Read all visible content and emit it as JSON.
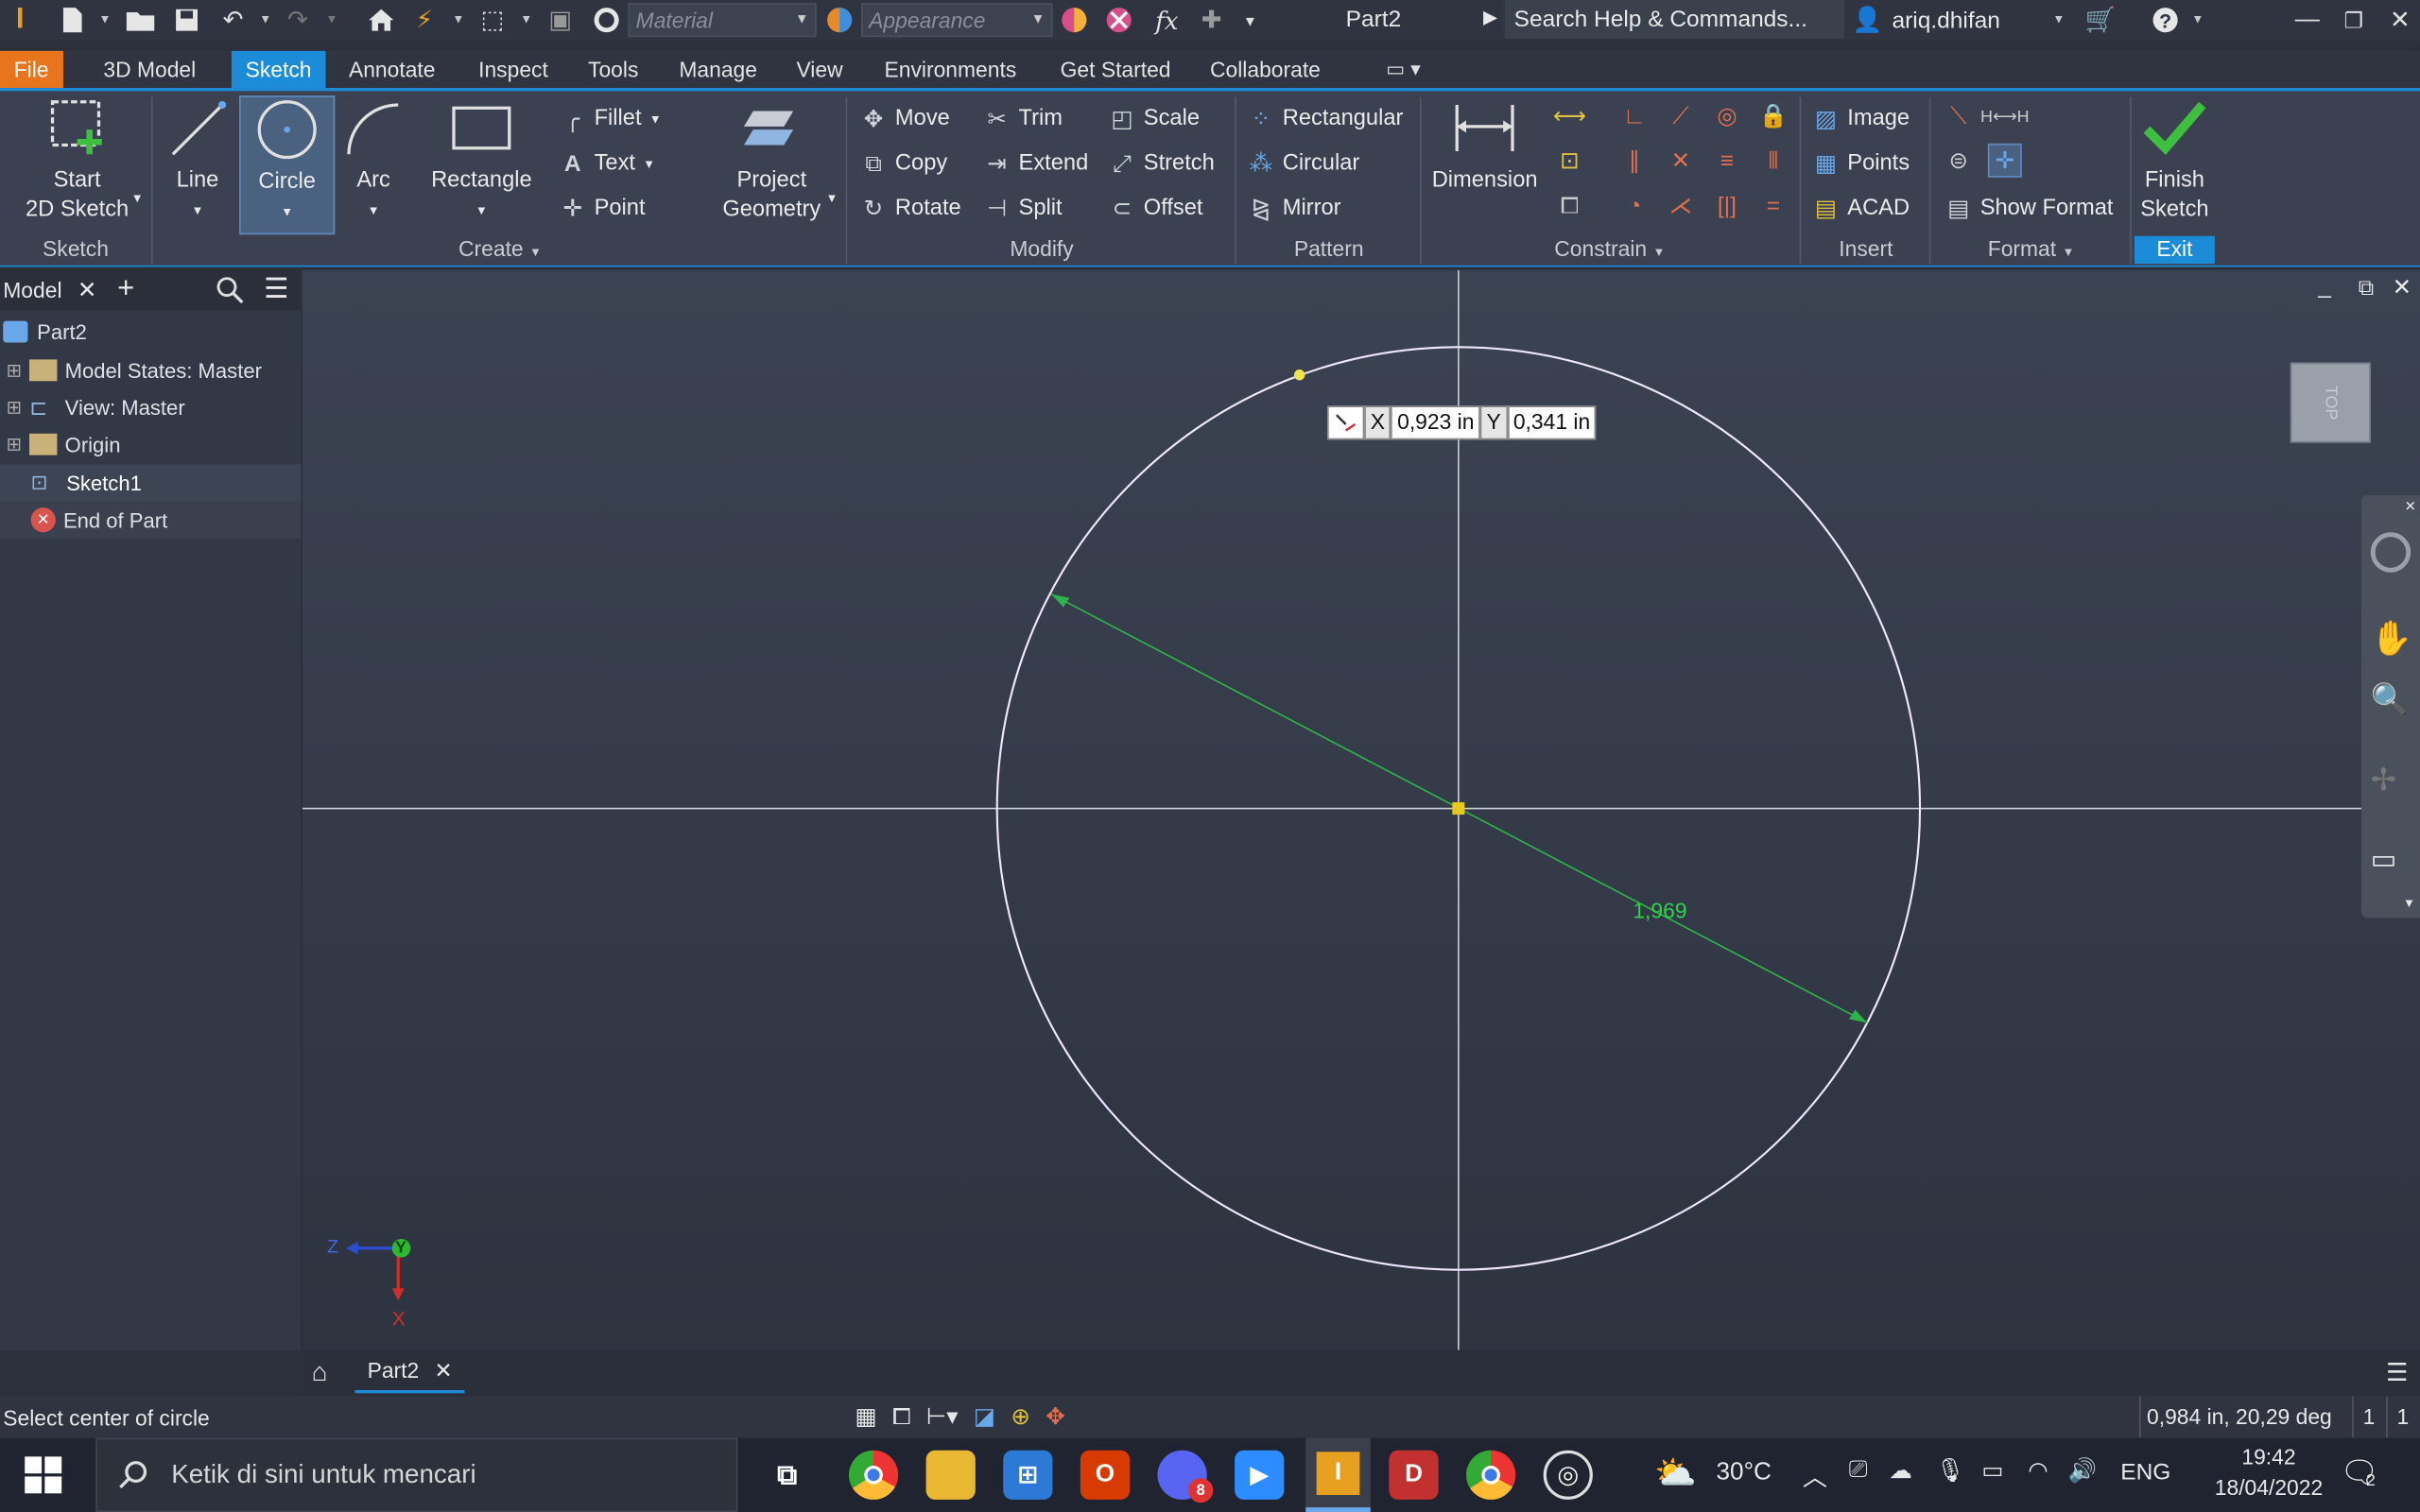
{
  "window": {
    "doc_title": "Part2",
    "search_placeholder": "Search Help & Commands...",
    "user": "ariq.dhifan"
  },
  "quick_access": {
    "material": "Material",
    "appearance": "Appearance"
  },
  "menu": [
    "File",
    "3D Model",
    "Sketch",
    "Annotate",
    "Inspect",
    "Tools",
    "Manage",
    "View",
    "Environments",
    "Get Started",
    "Collaborate"
  ],
  "ribbon": {
    "sketch_group": {
      "label": "Sketch",
      "start_line1": "Start",
      "start_line2": "2D Sketch"
    },
    "create_group": {
      "label": "Create",
      "line": "Line",
      "circle": "Circle",
      "arc": "Arc",
      "rectangle": "Rectangle",
      "fillet": "Fillet",
      "text": "Text",
      "point": "Point",
      "project_line1": "Project",
      "project_line2": "Geometry"
    },
    "modify_group": {
      "label": "Modify",
      "move": "Move",
      "copy": "Copy",
      "rotate": "Rotate",
      "trim": "Trim",
      "extend": "Extend",
      "split": "Split",
      "scale": "Scale",
      "stretch": "Stretch",
      "offset": "Offset"
    },
    "pattern_group": {
      "label": "Pattern",
      "rectangular": "Rectangular",
      "circular": "Circular",
      "mirror": "Mirror"
    },
    "constrain_group": {
      "label": "Constrain",
      "dimension": "Dimension"
    },
    "insert_group": {
      "label": "Insert",
      "image": "Image",
      "points": "Points",
      "acad": "ACAD"
    },
    "format_group": {
      "label": "Format",
      "show_format": "Show Format"
    },
    "exit_group": {
      "label": "Exit",
      "finish_line1": "Finish",
      "finish_line2": "Sketch"
    }
  },
  "browser": {
    "tab": "Model",
    "items": [
      {
        "label": "Part2"
      },
      {
        "label": "Model States: Master"
      },
      {
        "label": "View: Master"
      },
      {
        "label": "Origin"
      },
      {
        "label": "Sketch1"
      },
      {
        "label": "End of Part"
      }
    ]
  },
  "canvas": {
    "x_label": "X",
    "x_value": "0,923 in",
    "y_label": "Y",
    "y_value": "0,341 in",
    "dimension": "1,969",
    "viewcube": "TOP",
    "triad_z": "Z",
    "triad_y": "Y",
    "triad_x": "X"
  },
  "doc_tab": "Part2",
  "status": {
    "prompt": "Select center of circle",
    "readout": "0,984 in, 20,29 deg",
    "count1": "1",
    "count2": "1"
  },
  "taskbar": {
    "search_placeholder": "Ketik di sini untuk mencari",
    "temperature": "30°C",
    "language": "ENG",
    "time": "19:42",
    "date": "18/04/2022",
    "notifications": "2",
    "discord_badge": "8"
  }
}
